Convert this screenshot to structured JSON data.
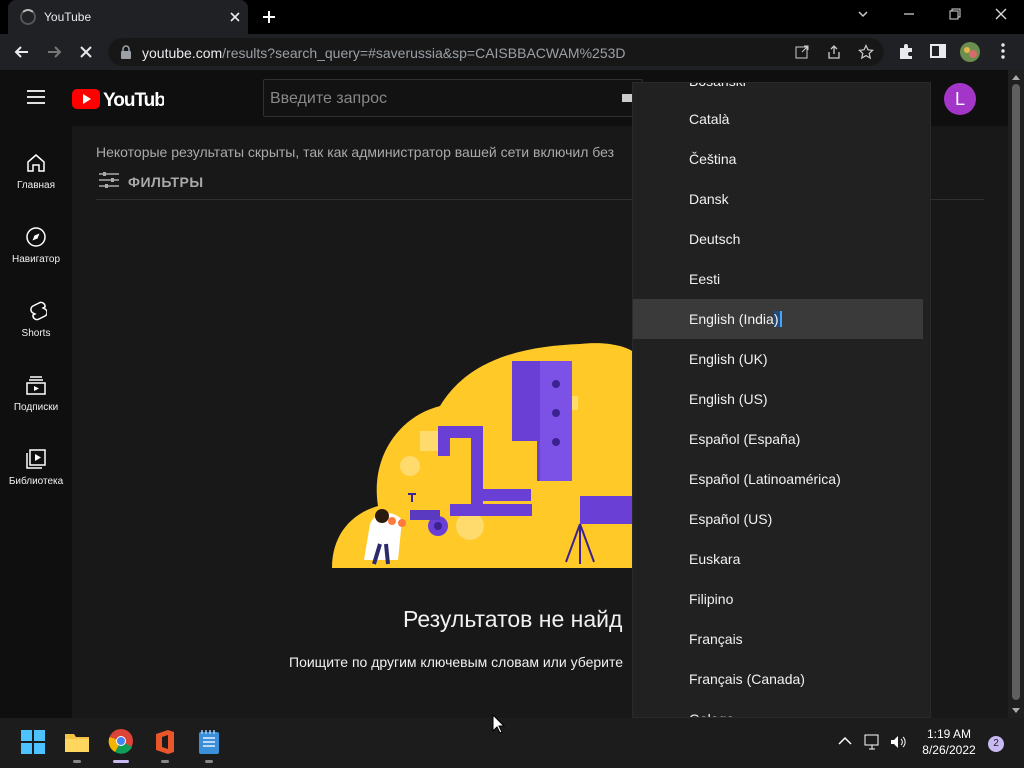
{
  "browser": {
    "tab_title": "YouTube",
    "url_domain": "youtube.com",
    "url_path": "/results?search_query=#saverussia&sp=CAISBBACWAM%253D"
  },
  "youtube": {
    "logo_text": "YouTube",
    "search_placeholder": "Введите запрос",
    "avatar_letter": "L",
    "guide": [
      {
        "label": "Главная",
        "icon": "home-icon"
      },
      {
        "label": "Навигатор",
        "icon": "compass-icon"
      },
      {
        "label": "Shorts",
        "icon": "shorts-icon"
      },
      {
        "label": "Подписки",
        "icon": "subscriptions-icon"
      },
      {
        "label": "Библиотека",
        "icon": "library-icon"
      }
    ],
    "notice": "Некоторые результаты скрыты, так как администратор вашей сети включил без",
    "filters_label": "ФИЛЬТРЫ",
    "no_results_title": "Результатов не найд",
    "no_results_hint": "Поищите по другим ключевым словам или уберите"
  },
  "language_menu": {
    "selected": "English (India)",
    "items": [
      "Bosanski",
      "Català",
      "Čeština",
      "Dansk",
      "Deutsch",
      "Eesti",
      "English (India)",
      "English (UK)",
      "English (US)",
      "Español (España)",
      "Español (Latinoamérica)",
      "Español (US)",
      "Euskara",
      "Filipino",
      "Français",
      "Français (Canada)",
      "Galego"
    ]
  },
  "taskbar": {
    "time": "1:19 AM",
    "date": "8/26/2022",
    "notification_count": "2",
    "apps": [
      "windows-start-icon",
      "file-explorer-icon",
      "chrome-icon",
      "office-icon",
      "notepad-icon"
    ]
  },
  "colors": {
    "youtube_red": "#ff0000",
    "avatar": "#a336c8",
    "accent_blue": "#3ea6ff",
    "illustration_yellow": "#ffc928",
    "illustration_purple": "#6a3fd6"
  }
}
